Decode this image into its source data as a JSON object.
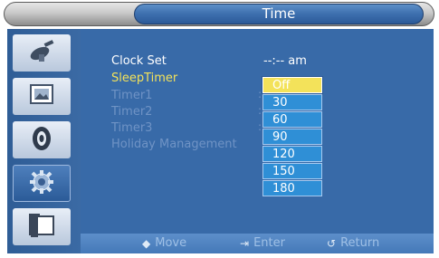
{
  "window": {
    "title": "Time"
  },
  "sidebar": {
    "items": [
      {
        "icon": "satellite-dish-icon"
      },
      {
        "icon": "picture-icon"
      },
      {
        "icon": "sound-icon"
      },
      {
        "icon": "setup-gear-icon"
      },
      {
        "icon": "input-source-icon"
      }
    ],
    "active_index": 3
  },
  "menu": {
    "items": [
      {
        "label": "Clock Set",
        "value": "--:-- am"
      },
      {
        "label": "SleepTimer",
        "value": ":"
      },
      {
        "label": "Timer1"
      },
      {
        "label": "Timer2"
      },
      {
        "label": "Timer3"
      },
      {
        "label": "Holiday Management"
      }
    ]
  },
  "dropdown": {
    "options": [
      "Off",
      "30",
      "60",
      "90",
      "120",
      "150",
      "180"
    ],
    "selected": "Off"
  },
  "footer": {
    "move": "Move",
    "enter": "Enter",
    "return": "Return"
  },
  "colors": {
    "accent_yellow": "#f3e25a",
    "panel_blue": "#386aa8",
    "option_blue": "#2f8fd6"
  }
}
